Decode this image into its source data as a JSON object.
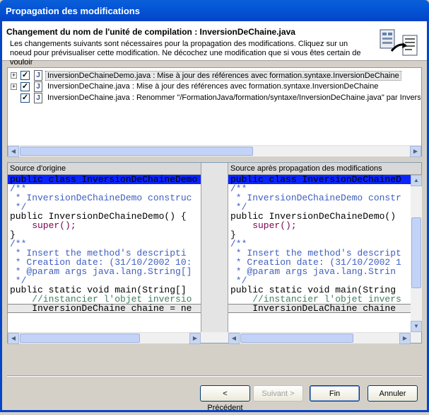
{
  "window": {
    "title": "Propagation des modifications"
  },
  "header": {
    "title": "Changement du nom de l'unité de compilation : InversionDeChaine.java",
    "description": "Les changements suivants sont nécessaires pour la propagation des modifications. Cliquez sur un noeud pour prévisualiser cette modification. Ne décochez une modification que si vous êtes certain de vouloir",
    "icon": "refactoring-icon"
  },
  "tree": {
    "items": [
      {
        "label": "InversionDeChaineDemo.java : Mise à jour des références avec formation.syntaxe.InversionDeChaine",
        "checked": true,
        "expandable": true,
        "selected": true
      },
      {
        "label": "InversionDeChaine.java : Mise à jour des références avec formation.syntaxe.InversionDeChaine",
        "checked": true,
        "expandable": true,
        "selected": false
      },
      {
        "label": "InversionDeChaine.java : Renommer \"/FormationJava/formation/syntaxe/InversionDeChaine.java\" par Inversion",
        "checked": true,
        "expandable": false,
        "selected": false
      }
    ]
  },
  "compare": {
    "left_title": "Source d'origine",
    "right_title": "Source après propagation des modifications",
    "left_lines": [
      "public class InversionDeChaineDemo",
      "/**",
      " * InversionDeChaineDemo construc",
      " */",
      "public InversionDeChaineDemo() {",
      "    super();",
      "}",
      "/**",
      " * Insert the method's descripti",
      " * Creation date: (31/10/2002 10:",
      " * @param args java.lang.String[]",
      " */",
      "public static void main(String[] ",
      "    //instancier l'objet inversio",
      "    InversionDeChaine chaine = ne"
    ],
    "right_lines": [
      "public class InversionDeChaineD",
      "/**",
      " * InversionDeChaineDemo constr",
      " */",
      "public InversionDeChaineDemo() ",
      "    super();",
      "}",
      "/**",
      " * Insert the method's descript",
      " * Creation date: (31/10/2002 1",
      " * @param args java.lang.Strin",
      " */",
      "public static void main(String",
      "    //instancier l'objet invers",
      "    InversionDeLaChaine chaine"
    ]
  },
  "buttons": {
    "back": "< Précédent",
    "next": "Suivant >",
    "finish": "Fin",
    "cancel": "Annuler"
  },
  "colors": {
    "titlebar": "#0455d6",
    "selection": "#0a24ff",
    "comment": "#3f5fbf",
    "keyword": "#7f0055"
  }
}
